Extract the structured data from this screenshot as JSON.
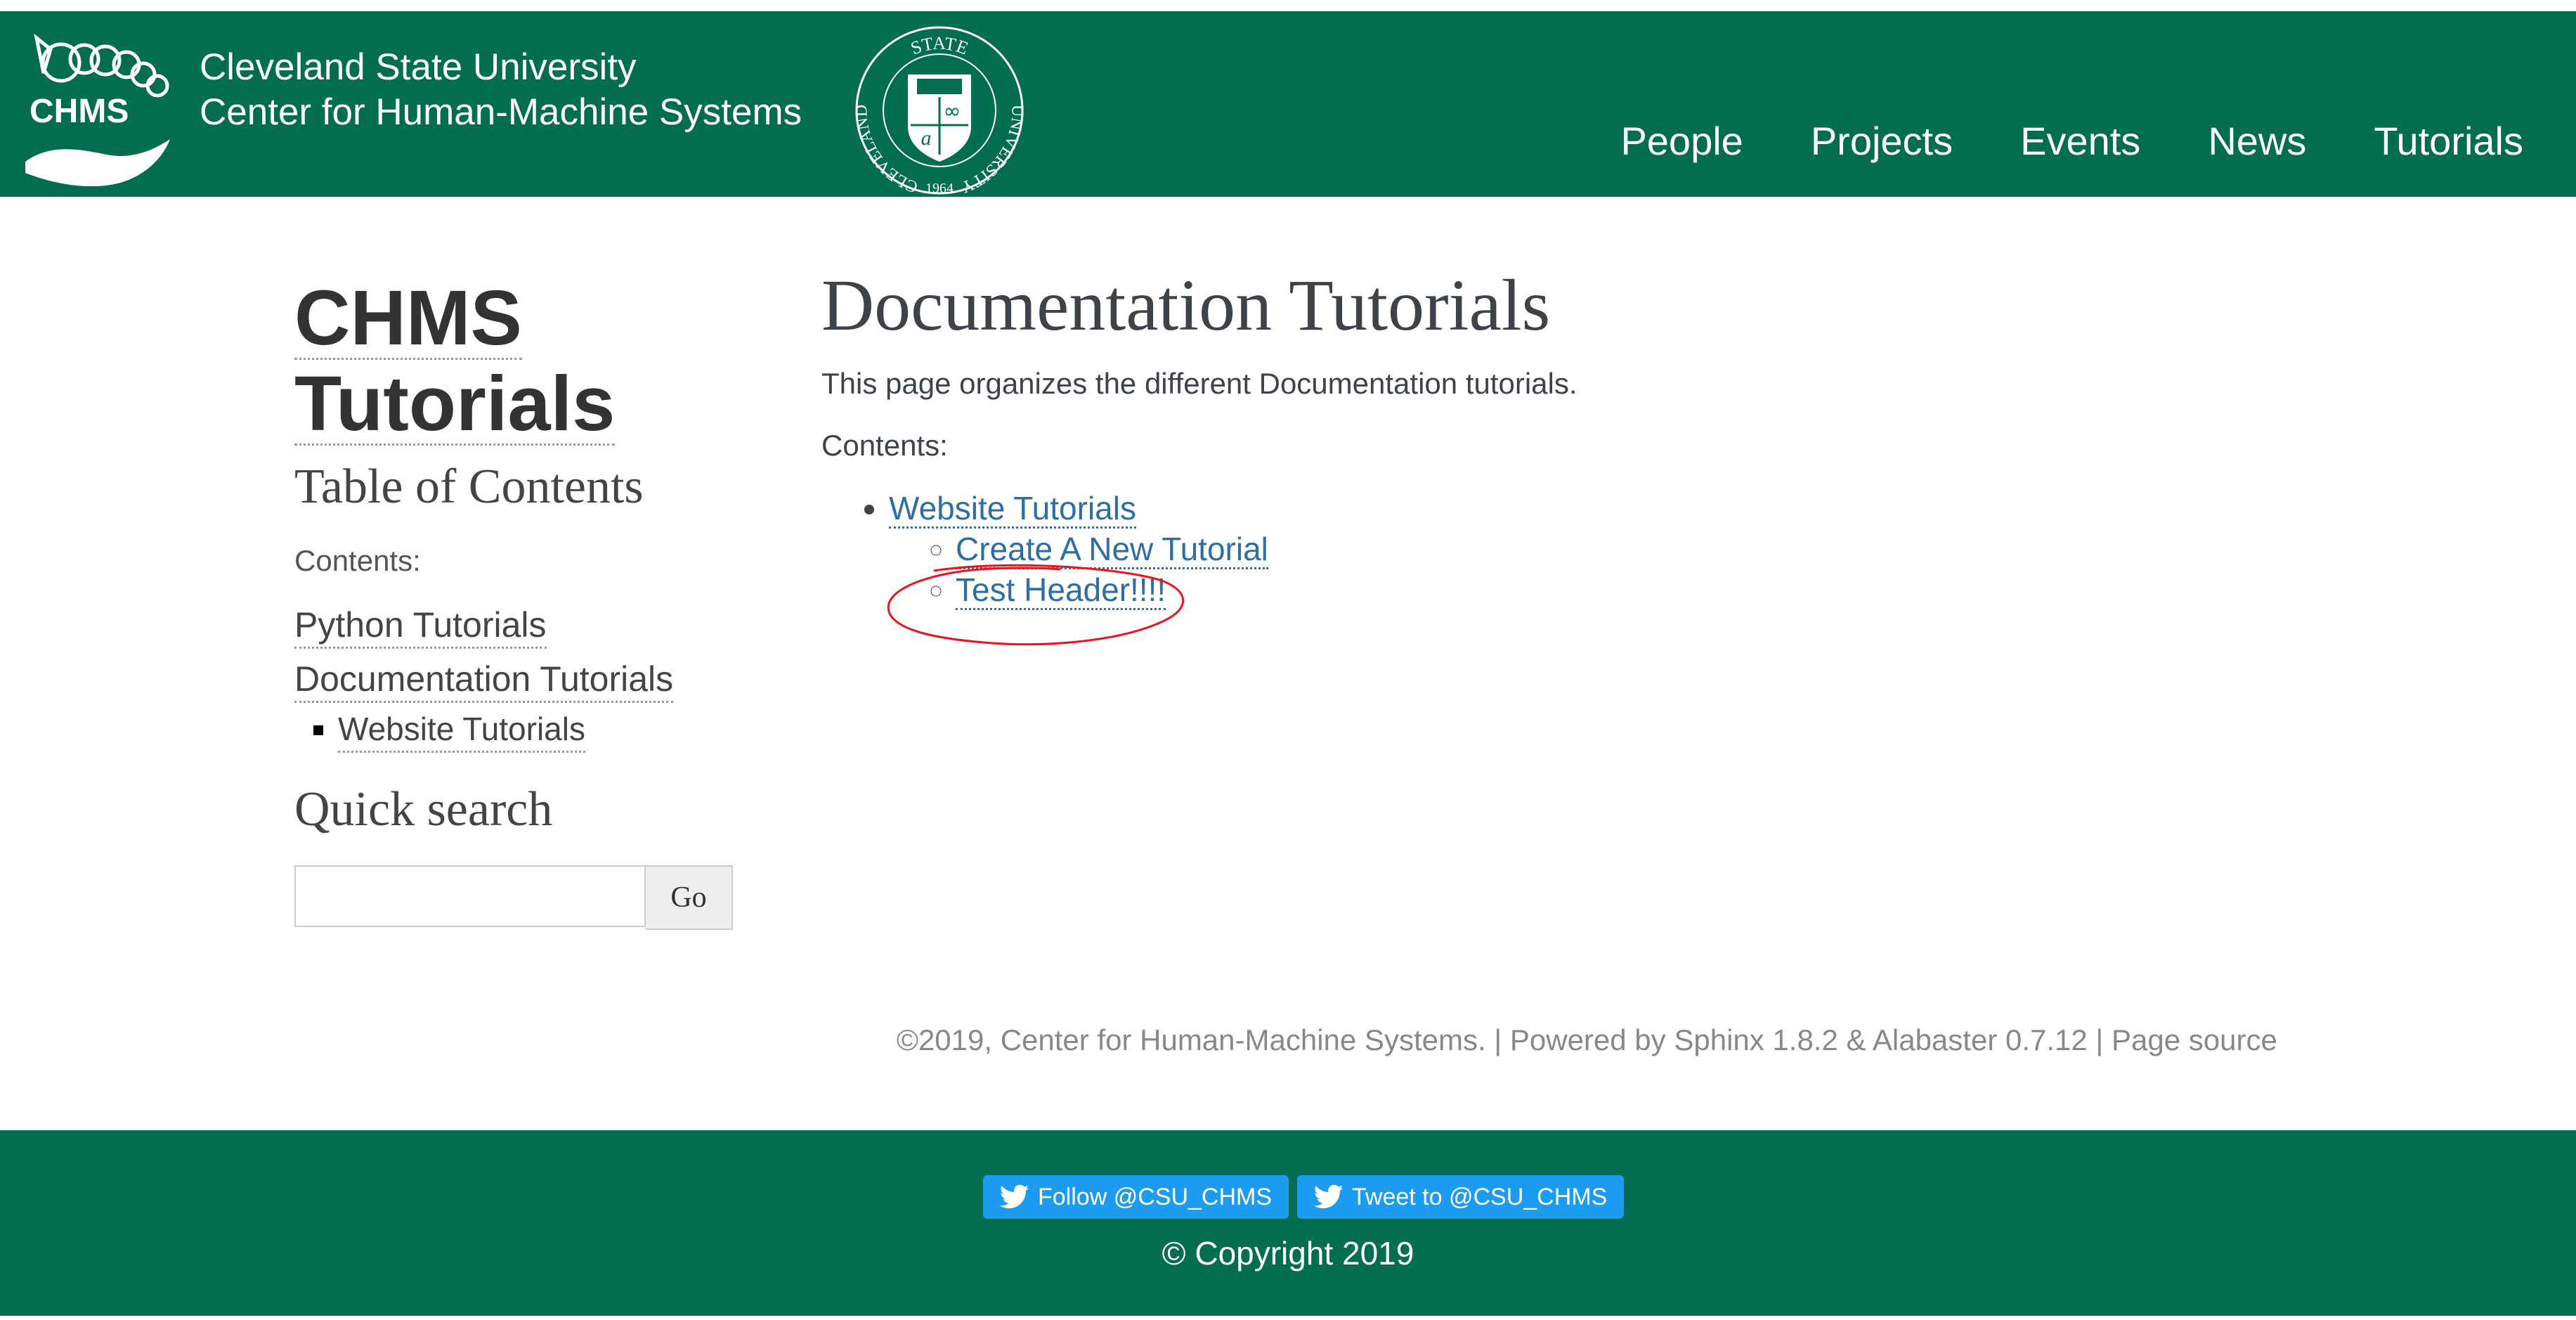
{
  "header": {
    "logo_text": "CHMS",
    "university_line1": "Cleveland State University",
    "university_line2": "Center for Human-Machine Systems",
    "seal_top": "STATE",
    "seal_left": "CLEVELAND",
    "seal_right": "UNIVERSITY",
    "seal_year": "1964",
    "nav": [
      {
        "label": "People"
      },
      {
        "label": "Projects"
      },
      {
        "label": "Events"
      },
      {
        "label": "News"
      },
      {
        "label": "Tutorials"
      }
    ],
    "colors": {
      "bar": "#036e4f",
      "text": "#ffffff"
    }
  },
  "sidebar": {
    "brand_line1": "CHMS",
    "brand_line2": "Tutorials",
    "toc_heading": "Table of Contents",
    "contents_caption": "Contents:",
    "links": [
      {
        "label": "Python Tutorials"
      },
      {
        "label": "Documentation Tutorials"
      }
    ],
    "sublinks": [
      {
        "label": "Website Tutorials"
      }
    ],
    "quick_search_heading": "Quick search",
    "search_value": "",
    "go_label": "Go"
  },
  "main": {
    "title": "Documentation Tutorials",
    "intro": "This page organizes the different Documentation tutorials.",
    "contents_caption": "Contents:",
    "toc": {
      "label": "Website Tutorials",
      "children": [
        {
          "label": "Create A New Tutorial"
        },
        {
          "label": "Test Header!!!!"
        }
      ]
    },
    "link_color": "#2c6ea5",
    "annotation_color": "#e8151b"
  },
  "footer_note": {
    "text": "©2019, Center for Human-Machine Systems. | Powered by Sphinx 1.8.2 & Alabaster 0.7.12 | Page source"
  },
  "bottom_bar": {
    "follow_label": "Follow @CSU_CHMS",
    "tweet_label": "Tweet to @CSU_CHMS",
    "icon": "twitter-bird-icon",
    "button_color": "#1d9bf0",
    "copyright": "© Copyright 2019"
  }
}
